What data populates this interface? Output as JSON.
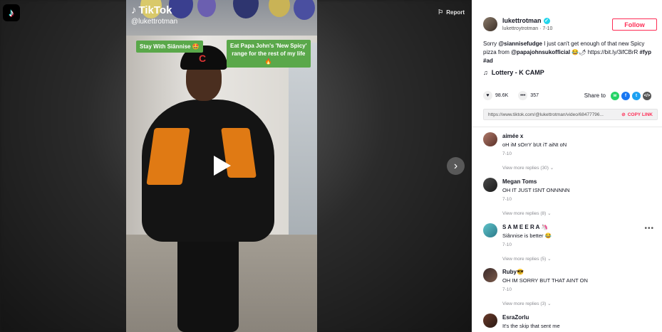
{
  "app": {
    "logo_icon": "tiktok-logo-icon",
    "report_label": "Report"
  },
  "video": {
    "watermark_brand": "TikTok",
    "watermark_user": "@lukettrotman",
    "caption_left": "Stay With Siânnise 🤩",
    "caption_right_line1": "Eat Papa John's 'New Spicy'",
    "caption_right_line2": "range for the rest of my life",
    "caption_right_line3": "🔥",
    "play_icon": "play-icon",
    "next_icon": "chevron-right-icon"
  },
  "author": {
    "username": "lukettrotman",
    "handle": "lukettroytrotman",
    "date": "7-10",
    "follow_label": "Follow"
  },
  "description": {
    "part1": "Sorry ",
    "mention1": "@siannisefudge",
    "part2": " I just can't get enough of that new Spicy pizza from ",
    "mention2": "@papajohnsukofficial",
    "part3": " 😂🌶 https://bit.ly/3ifCBrR ",
    "tag1": "#fyp",
    "tag2": "#ad"
  },
  "music": {
    "title": "Lottery - K CAMP"
  },
  "stats": {
    "likes": "98.6K",
    "comments": "357",
    "share_label": "Share to"
  },
  "link": {
    "url": "https://www.tiktok.com/@lukettrotman/video/68477796...",
    "copy_label": "COPY LINK"
  },
  "comments": [
    {
      "name": "aimée x",
      "text": "oH iM sOrrY bUt iT aiNt oN",
      "date": "7-10",
      "replies": "View more replies (30)"
    },
    {
      "name": "Megan Toms",
      "text": "OH IT JUST ISNT ONNNNN",
      "date": "7-10",
      "replies": "View more replies (8)"
    },
    {
      "name": "S A M E E R A 🦄",
      "text": "Siânnise is better 😂",
      "date": "7-10",
      "replies": "View more replies (5)"
    },
    {
      "name": "Ruby😎",
      "text": "OH IM SORRY BUT THAT AINT ON",
      "date": "7-10",
      "replies": "View more replies (3)"
    },
    {
      "name": "EsraZorlu",
      "text": "It's the skip that sent me",
      "date": "",
      "replies": ""
    }
  ],
  "colors": {
    "accent": "#fe2c55",
    "verified": "#20d5ec",
    "caption_bg": "#5aa84a"
  }
}
